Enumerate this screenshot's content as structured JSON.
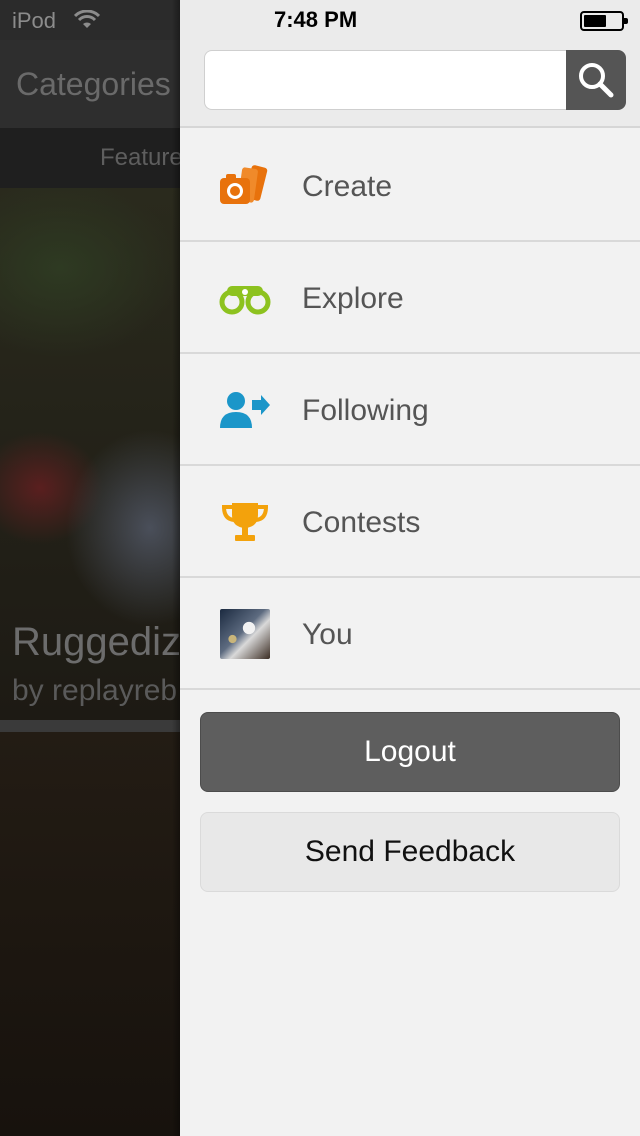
{
  "status_bar": {
    "carrier": "iPod",
    "time": "7:48 PM"
  },
  "background": {
    "nav_title": "Categories",
    "tab_label": "Feature",
    "photo_title": "Ruggediz",
    "photo_byline": "by replayreb"
  },
  "search": {
    "placeholder": "",
    "value": ""
  },
  "menu": {
    "items": [
      {
        "label": "Create",
        "icon": "camera-cards-icon",
        "color": "#e8720c"
      },
      {
        "label": "Explore",
        "icon": "binoculars-icon",
        "color": "#8dc21f"
      },
      {
        "label": "Following",
        "icon": "person-arrow-icon",
        "color": "#1b96c9"
      },
      {
        "label": "Contests",
        "icon": "trophy-icon",
        "color": "#f3a20c"
      },
      {
        "label": "You",
        "icon": "avatar"
      }
    ]
  },
  "buttons": {
    "logout": "Logout",
    "feedback": "Send Feedback"
  }
}
